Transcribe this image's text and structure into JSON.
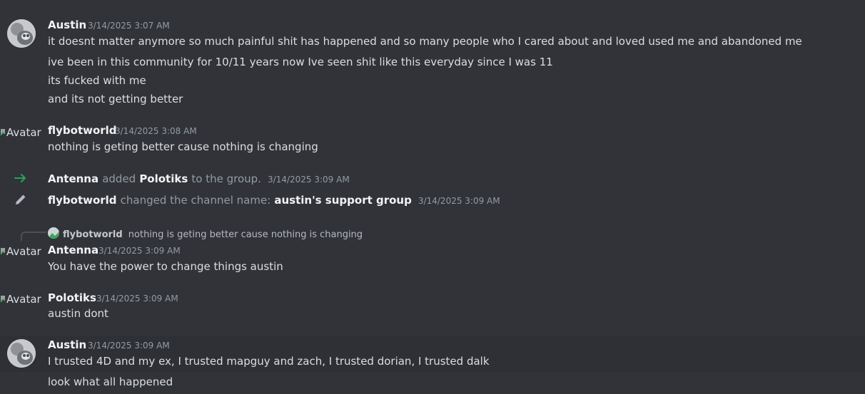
{
  "messages": [
    {
      "author": "Austin",
      "timestamp": "3/14/2025 3:07 AM",
      "lines": [
        "it doesnt matter anymore so much painful shit has happened and so many people who I cared about and loved used me and abandoned me",
        "ive been in this community for 10/11 years now Ive seen shit like this everyday since I was 11",
        "its fucked with me",
        "and its not getting better"
      ]
    },
    {
      "author": "flybotworld",
      "avatar_alt": "Avatar",
      "timestamp": "3/14/2025 3:08 AM",
      "lines": [
        "nothing is geting better cause nothing is changing"
      ]
    },
    {
      "author": "Antenna",
      "avatar_alt": "Avatar",
      "timestamp": "3/14/2025 3:09 AM",
      "reply_to": {
        "author": "flybotworld",
        "text": "nothing is geting better cause nothing is changing"
      },
      "lines": [
        "You have the power to change things austin"
      ]
    },
    {
      "author": "Polotiks",
      "avatar_alt": "Avatar",
      "timestamp": "3/14/2025 3:09 AM",
      "lines": [
        "austin dont"
      ]
    },
    {
      "author": "Austin",
      "timestamp": "3/14/2025 3:09 AM",
      "lines": [
        "I trusted 4D and my ex, I trusted mapguy and zach, I trusted dorian, I trusted dalk",
        "look what all happened"
      ]
    }
  ],
  "system_events": [
    {
      "icon": "arrow-right-icon",
      "icon_color": "#23a55a",
      "actor": "Antenna",
      "verb": "added",
      "target": "Polotiks",
      "suffix": "to the group.",
      "timestamp": "3/14/2025 3:09 AM"
    },
    {
      "icon": "pencil-icon",
      "icon_color": "#b5bac1",
      "actor": "flybotworld",
      "verb": "changed the channel name:",
      "target": "austin's support group",
      "timestamp": "3/14/2025 3:09 AM"
    }
  ],
  "colors": {
    "background": "#313338",
    "hover_row": "#2e3035",
    "username": "#f2f3f5",
    "message_text": "#dbdee1",
    "timestamp": "#949ba4",
    "add_arrow": "#23a55a"
  }
}
